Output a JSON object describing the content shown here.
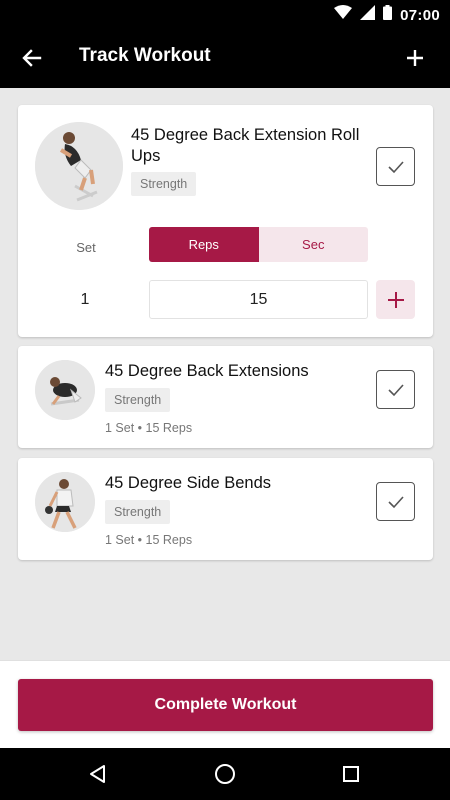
{
  "status_bar": {
    "time": "07:00"
  },
  "app_bar": {
    "title": "Track Workout"
  },
  "colors": {
    "accent": "#a61946",
    "accent_light": "#f5e6eb",
    "app_bar": "#000000",
    "background": "#e8e8e8"
  },
  "icons": {
    "back": "arrow-left",
    "add": "plus",
    "check": "checkmark",
    "add_set": "plus",
    "nav_back": "triangle-back",
    "nav_home": "circle-home",
    "nav_recents": "square-recents"
  },
  "active_exercise": {
    "name": "45 Degree Back Extension Roll Ups",
    "category": "Strength",
    "set_column_label": "Set",
    "mode_options": [
      "Reps",
      "Sec"
    ],
    "selected_mode": "Reps",
    "current_set": "1",
    "reps_value": "15"
  },
  "exercises": [
    {
      "name": "45 Degree Back Extensions",
      "category": "Strength",
      "summary": "1 Set • 15 Reps"
    },
    {
      "name": "45 Degree Side Bends",
      "category": "Strength",
      "summary": "1 Set • 15 Reps"
    }
  ],
  "footer": {
    "complete_label": "Complete Workout"
  }
}
